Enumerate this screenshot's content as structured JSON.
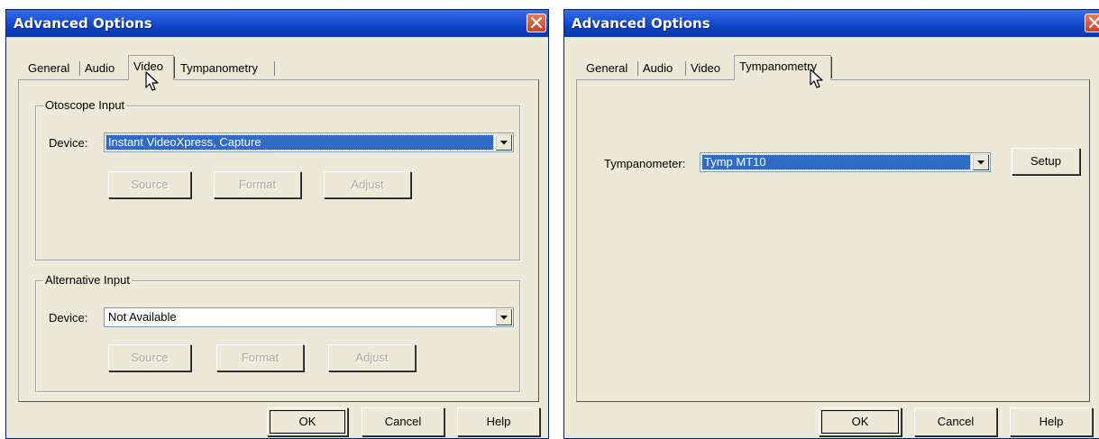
{
  "dialogs": [
    {
      "title": "Advanced Options",
      "tabs": [
        "General",
        "Audio",
        "Video",
        "Tympanometry"
      ],
      "active_tab": "Video",
      "otoscope_group": {
        "label": "Otoscope Input",
        "device_label": "Device:",
        "device_value": "Instant VideoXpress, Capture",
        "buttons": [
          "Source",
          "Format",
          "Adjust"
        ]
      },
      "alternative_group": {
        "label": "Alternative Input",
        "device_label": "Device:",
        "device_value": "Not Available",
        "buttons": [
          "Source",
          "Format",
          "Adjust"
        ]
      },
      "footer_buttons": [
        "OK",
        "Cancel",
        "Help"
      ]
    },
    {
      "title": "Advanced Options",
      "tabs": [
        "General",
        "Audio",
        "Video",
        "Tympanometry"
      ],
      "active_tab": "Tympanometry",
      "tympanometer_label": "Tympanometer:",
      "tympanometer_value": "Tymp MT10",
      "setup_label": "Setup",
      "footer_buttons": [
        "OK",
        "Cancel",
        "Help"
      ]
    }
  ],
  "icons": {
    "close": "close-icon",
    "dropdown": "dropdown-arrow-icon",
    "cursor": "mouse-pointer-icon"
  },
  "colors": {
    "titlebar": "#0c3fc2",
    "dialog_bg": "#ece9d8",
    "selection": "#316ac5",
    "close_button": "#d9573a"
  }
}
